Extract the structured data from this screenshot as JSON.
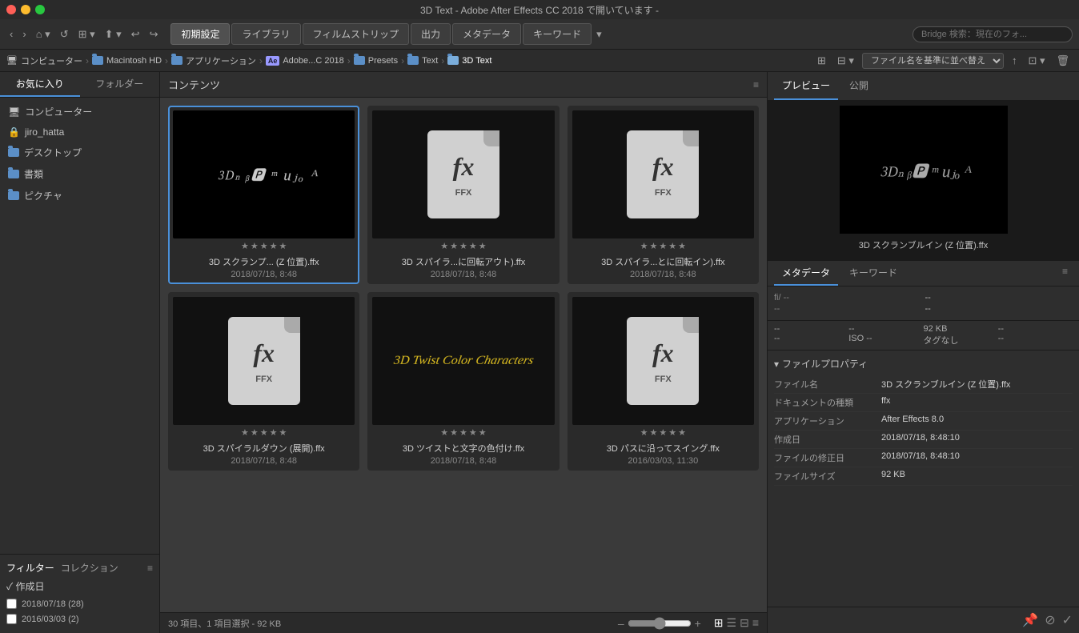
{
  "window": {
    "title": "3D Text - Adobe After Effects CC 2018 で開いています -"
  },
  "nav": {
    "tabs": [
      {
        "label": "初期設定",
        "active": true
      },
      {
        "label": "ライブラリ",
        "active": false
      },
      {
        "label": "フィルムストリップ",
        "active": false
      },
      {
        "label": "出力",
        "active": false
      },
      {
        "label": "メタデータ",
        "active": false
      },
      {
        "label": "キーワード",
        "active": false
      }
    ],
    "search_placeholder": "Bridge 検索：現在のフォ...",
    "more_icon": "▾"
  },
  "breadcrumb": {
    "items": [
      {
        "label": "コンピューター",
        "type": "computer"
      },
      {
        "label": "Macintosh HD",
        "type": "folder"
      },
      {
        "label": "アプリケーション",
        "type": "folder"
      },
      {
        "label": "Adobe...C 2018",
        "type": "ae"
      },
      {
        "label": "Presets",
        "type": "folder"
      },
      {
        "label": "Text",
        "type": "folder"
      },
      {
        "label": "3D Text",
        "type": "folder",
        "active": true
      }
    ],
    "sort_label": "ファイル名を基準に並べ替え"
  },
  "sidebar": {
    "tabs": [
      {
        "label": "お気に入り",
        "active": true
      },
      {
        "label": "フォルダー",
        "active": false
      }
    ],
    "items": [
      {
        "label": "コンピューター",
        "icon": "computer"
      },
      {
        "label": "jiro_hatta",
        "icon": "user"
      },
      {
        "label": "デスクトップ",
        "icon": "folder-blue"
      },
      {
        "label": "書類",
        "icon": "folder-blue"
      },
      {
        "label": "ピクチャ",
        "icon": "folder-blue"
      }
    ]
  },
  "filter": {
    "tabs": [
      {
        "label": "フィルター",
        "active": true
      },
      {
        "label": "コレクション",
        "active": false
      }
    ],
    "sections": [
      {
        "label": "作成日",
        "items": [
          {
            "label": "2018/07/18 (28)",
            "checked": false
          },
          {
            "label": "2016/03/03 (2)",
            "checked": false
          }
        ]
      }
    ]
  },
  "content": {
    "title": "コンテンツ",
    "footer": {
      "info": "30 項目、1 項目選択 - 92 KB"
    },
    "items": [
      {
        "id": 1,
        "name": "3D スクランプ... (Z 位置).ffx",
        "date": "2018/07/18, 8:48",
        "type": "preview",
        "selected": true
      },
      {
        "id": 2,
        "name": "3D スパイラ...に回転アウト).ffx",
        "date": "2018/07/18, 8:48",
        "type": "ffx",
        "selected": false
      },
      {
        "id": 3,
        "name": "3D スパイラ...とに回転イン).ffx",
        "date": "2018/07/18, 8:48",
        "type": "ffx",
        "selected": false
      },
      {
        "id": 4,
        "name": "3D スパイラルダウン (展開).ffx",
        "date": "2018/07/18, 8:48",
        "type": "ffx",
        "selected": false
      },
      {
        "id": 5,
        "name": "3D ツイストと文字の色付け.ffx",
        "date": "2018/07/18, 8:48",
        "type": "twist",
        "selected": false
      },
      {
        "id": 6,
        "name": "3D パスに沿ってスイング.ffx",
        "date": "2016/03/03, 11:30",
        "type": "ffx",
        "selected": false
      }
    ]
  },
  "preview_panel": {
    "tabs": [
      {
        "label": "プレビュー",
        "active": true
      },
      {
        "label": "公開",
        "active": false
      }
    ],
    "filename": "3D スクランブルイン (Z 位置).ffx"
  },
  "metadata_panel": {
    "tabs": [
      {
        "label": "メタデータ",
        "active": true
      },
      {
        "label": "キーワード",
        "active": false
      }
    ],
    "stats_row1": [
      "fi/ --",
      "--",
      "--"
    ],
    "stats_row2": [
      "--",
      "--",
      "92 KB",
      "--"
    ],
    "stats_row3": [
      "--",
      "ISO --",
      "タグなし",
      "--"
    ],
    "file_props_label": "ファイルプロパティ",
    "props": [
      {
        "key": "ファイル名",
        "val": "3D スクランブルイン (Z 位置).ffx"
      },
      {
        "key": "ドキュメントの種類",
        "val": "ffx"
      },
      {
        "key": "アプリケーション",
        "val": "After Effects 8.0"
      },
      {
        "key": "作成日",
        "val": "2018/07/18, 8:48:10"
      },
      {
        "key": "ファイルの修正日",
        "val": "2018/07/18, 8:48:10"
      },
      {
        "key": "ファイルサイズ",
        "val": "92 KB"
      }
    ]
  }
}
